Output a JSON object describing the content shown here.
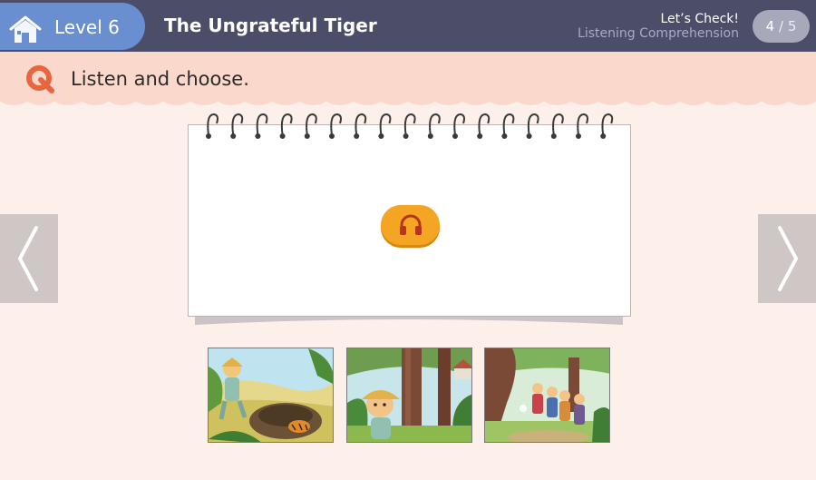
{
  "header": {
    "level_label": "Level 6",
    "story_title": "The Ungrateful Tiger",
    "section_title": "Let’s Check!",
    "section_subtitle": "Listening Comprehension",
    "page_current": "4",
    "page_separator": "/",
    "page_total": "5",
    "home_icon": "home-icon"
  },
  "instruction": {
    "icon": "q-icon",
    "text": "Listen and choose."
  },
  "notepad": {
    "audio_button_icon": "headphones-icon",
    "ring_count": 17
  },
  "navigation": {
    "prev_icon": "chevron-left-icon",
    "next_icon": "chevron-right-icon"
  },
  "choices": [
    {
      "id": "choice-1",
      "scene": "man with straw hat walking past tiger in pit"
    },
    {
      "id": "choice-2",
      "scene": "boy with straw hat peeking from behind tree"
    },
    {
      "id": "choice-3",
      "scene": "group of villagers in the forest"
    }
  ],
  "colors": {
    "topbar": "#4c4d68",
    "level_pill": "#6a8fd1",
    "instruction_band": "#fbd8cc",
    "background": "#fdf0ea",
    "accent": "#f5a524",
    "q_icon": "#e8663f"
  }
}
